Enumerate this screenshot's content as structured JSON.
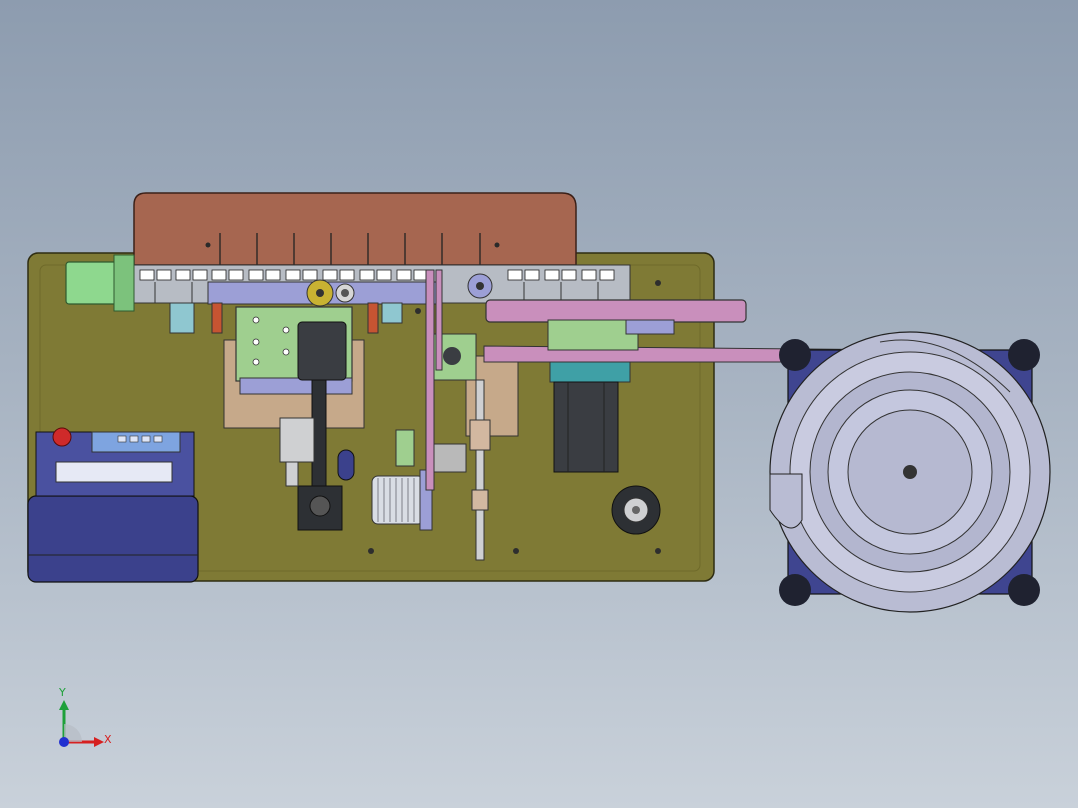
{
  "viewport": {
    "background_top": "#8d9caf",
    "background_bottom": "#c9d1da"
  },
  "model": {
    "base_plate_color": "#7f7a35",
    "top_cover_color": "#a66650",
    "bowl_feeder_color": "#b9bcd3",
    "bowl_base_color": "#3f4590",
    "control_box_color": "#3b418c",
    "rail_color": "#c98fbc",
    "motor_color": "#3a3d42",
    "board_color": "#9fcf8f"
  },
  "triad": {
    "x_label": "X",
    "y_label": "Y",
    "x_color": "#d62020",
    "y_color": "#1ea03a",
    "z_color": "#2030d0"
  }
}
